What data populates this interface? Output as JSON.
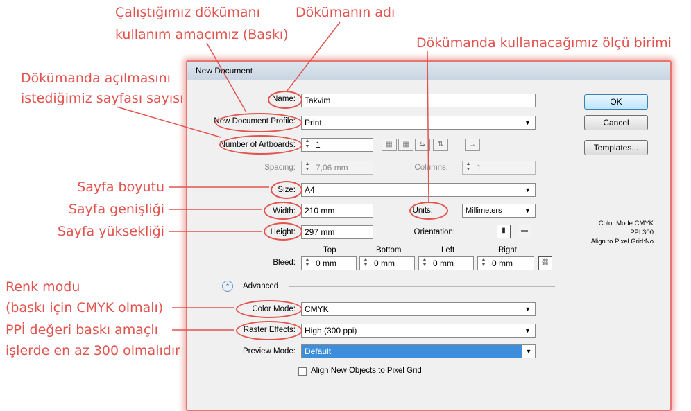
{
  "annotations": {
    "doc_purpose_line1": "Çalıştığımız dökümanı",
    "doc_purpose_line2": "kullanım amacımız (Baskı)",
    "doc_name": "Dökümanın adı",
    "units_desc": "Dökümanda kullanacağımız ölçü birimi",
    "artboards_line1": "Dökümanda açılmasını",
    "artboards_line2": "istediğimiz sayfası sayısı",
    "page_size": "Sayfa boyutu",
    "page_width": "Sayfa genişliği",
    "page_height": "Sayfa yüksekliği",
    "color_mode_line1": "Renk modu",
    "color_mode_line2": "(baskı için CMYK olmalı)",
    "ppi_line1": "PPİ değeri baskı amaçlı",
    "ppi_line2": "işlerde en az 300 olmalıdır"
  },
  "dialog": {
    "title": "New Document",
    "name_label": "Name:",
    "name_value": "Takvim",
    "profile_label": "New Document Profile:",
    "profile_value": "Print",
    "artboards_label": "Number of Artboards:",
    "artboards_value": "1",
    "spacing_label": "Spacing:",
    "spacing_value": "7,06 mm",
    "columns_label": "Columns:",
    "columns_value": "1",
    "size_label": "Size:",
    "size_value": "A4",
    "width_label": "Width:",
    "width_value": "210 mm",
    "units_label": "Units:",
    "units_value": "Millimeters",
    "height_label": "Height:",
    "height_value": "297 mm",
    "orientation_label": "Orientation:",
    "bleed_label": "Bleed:",
    "bleed_top_label": "Top",
    "bleed_bottom_label": "Bottom",
    "bleed_left_label": "Left",
    "bleed_right_label": "Right",
    "bleed_top": "0 mm",
    "bleed_bottom": "0 mm",
    "bleed_left": "0 mm",
    "bleed_right": "0 mm",
    "advanced_label": "Advanced",
    "color_mode_label": "Color Mode:",
    "color_mode_value": "CMYK",
    "raster_label": "Raster Effects:",
    "raster_value": "High (300 ppi)",
    "preview_label": "Preview Mode:",
    "preview_value": "Default",
    "align_label": "Align New Objects to Pixel Grid",
    "ok_label": "OK",
    "cancel_label": "Cancel",
    "templates_label": "Templates...",
    "info_color_mode": "Color Mode:CMYK",
    "info_ppi": "PPI:300",
    "info_align": "Align to Pixel Grid:No"
  },
  "colors": {
    "annotation": "#e2534e",
    "selection": "#3d8fdb"
  }
}
